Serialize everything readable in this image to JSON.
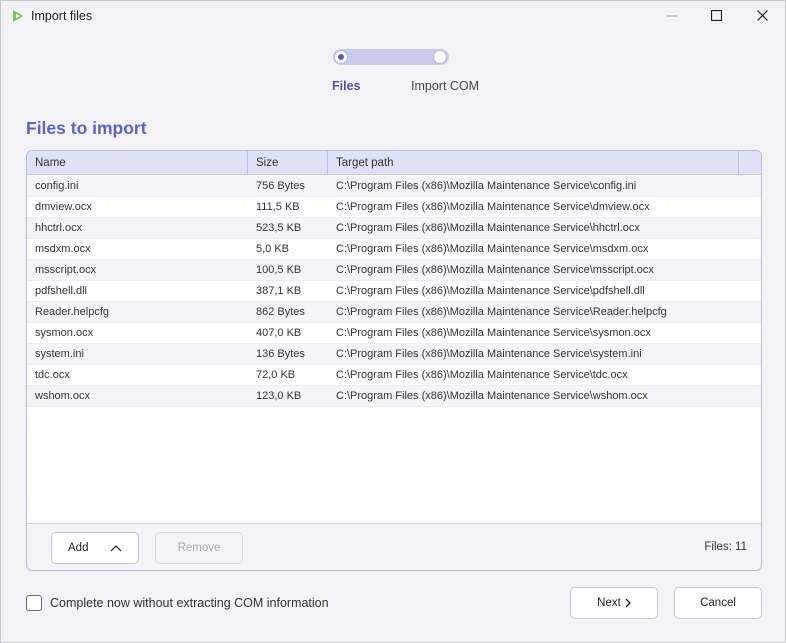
{
  "window": {
    "title": "Import files"
  },
  "stepper": {
    "steps": [
      {
        "label": "Files"
      },
      {
        "label": "Import COM"
      }
    ]
  },
  "heading": "Files to import",
  "table": {
    "columns": [
      "Name",
      "Size",
      "Target path"
    ],
    "rows": [
      {
        "name": "config.ini",
        "size": "756 Bytes",
        "path": "C:\\Program Files (x86)\\Mozilla Maintenance Service\\config.ini"
      },
      {
        "name": "dmview.ocx",
        "size": "111,5 KB",
        "path": "C:\\Program Files (x86)\\Mozilla Maintenance Service\\dmview.ocx"
      },
      {
        "name": "hhctrl.ocx",
        "size": "523,5 KB",
        "path": "C:\\Program Files (x86)\\Mozilla Maintenance Service\\hhctrl.ocx"
      },
      {
        "name": "msdxm.ocx",
        "size": "5,0 KB",
        "path": "C:\\Program Files (x86)\\Mozilla Maintenance Service\\msdxm.ocx"
      },
      {
        "name": "msscript.ocx",
        "size": "100,5 KB",
        "path": "C:\\Program Files (x86)\\Mozilla Maintenance Service\\msscript.ocx"
      },
      {
        "name": "pdfshell.dll",
        "size": "387,1 KB",
        "path": "C:\\Program Files (x86)\\Mozilla Maintenance Service\\pdfshell.dll"
      },
      {
        "name": "Reader.helpcfg",
        "size": "862 Bytes",
        "path": "C:\\Program Files (x86)\\Mozilla Maintenance Service\\Reader.helpcfg"
      },
      {
        "name": "sysmon.ocx",
        "size": "407,0 KB",
        "path": "C:\\Program Files (x86)\\Mozilla Maintenance Service\\sysmon.ocx"
      },
      {
        "name": "system.ini",
        "size": "136 Bytes",
        "path": "C:\\Program Files (x86)\\Mozilla Maintenance Service\\system.ini"
      },
      {
        "name": "tdc.ocx",
        "size": "72,0 KB",
        "path": "C:\\Program Files (x86)\\Mozilla Maintenance Service\\tdc.ocx"
      },
      {
        "name": "wshom.ocx",
        "size": "123,0 KB",
        "path": "C:\\Program Files (x86)\\Mozilla Maintenance Service\\wshom.ocx"
      }
    ]
  },
  "footer": {
    "add_label": "Add",
    "remove_label": "Remove",
    "files_count": "Files: 11"
  },
  "options": {
    "complete_label": "Complete now without extracting COM information"
  },
  "actions": {
    "next_label": "Next",
    "cancel_label": "Cancel"
  },
  "icons": {
    "app": "app-logo-icon",
    "minimize": "minimize-icon",
    "maximize": "maximize-icon",
    "close": "close-icon",
    "add_menu": "chevron-up-icon",
    "next": "chevron-right-icon"
  },
  "colors": {
    "accent": "#5a64c6",
    "header_bg": "#dfe2f7",
    "border": "#b8bde3"
  }
}
